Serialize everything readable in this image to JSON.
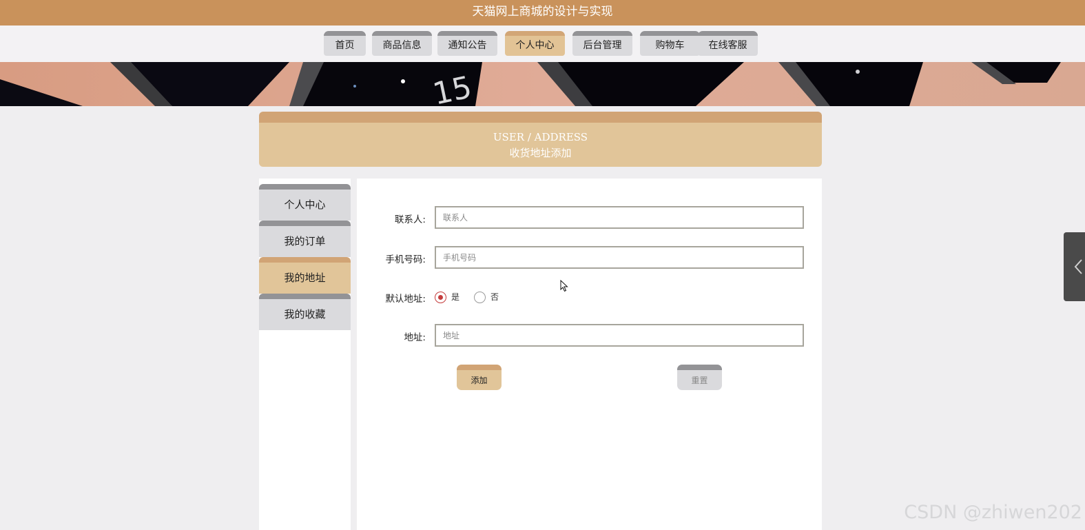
{
  "header": {
    "title": "天猫网上商城的设计与实现"
  },
  "nav": {
    "items": [
      {
        "label": "首页"
      },
      {
        "label": "商品信息"
      },
      {
        "label": "通知公告"
      },
      {
        "label": "个人中心",
        "active": true
      },
      {
        "label": "后台管理"
      },
      {
        "label": "购物车"
      },
      {
        "label": "在线客服"
      }
    ]
  },
  "page_header": {
    "en": "USER / ADDRESS",
    "zh": "收货地址添加"
  },
  "sidebar": {
    "items": [
      {
        "label": "个人中心"
      },
      {
        "label": "我的订单"
      },
      {
        "label": "我的地址",
        "active": true
      },
      {
        "label": "我的收藏"
      }
    ]
  },
  "form": {
    "contact": {
      "label": "联系人:",
      "placeholder": "联系人",
      "value": ""
    },
    "phone": {
      "label": "手机号码:",
      "placeholder": "手机号码",
      "value": ""
    },
    "default_address": {
      "label": "默认地址:",
      "options": [
        {
          "label": "是",
          "checked": true
        },
        {
          "label": "否",
          "checked": false
        }
      ]
    },
    "address": {
      "label": "地址:",
      "placeholder": "地址",
      "value": ""
    },
    "submit_label": "添加",
    "reset_label": "重置"
  },
  "watermark": "CSDN @zhiwen202",
  "colors": {
    "brand": "#c9925b",
    "accent": "#e1c599",
    "accent_top": "#d1a475",
    "inactive": "#dadadd",
    "inactive_top": "#939396",
    "radio_checked": "#c43c3c"
  },
  "icons": {
    "side_tab": "chevron-left-icon",
    "cursor": "mouse-pointer-icon"
  }
}
